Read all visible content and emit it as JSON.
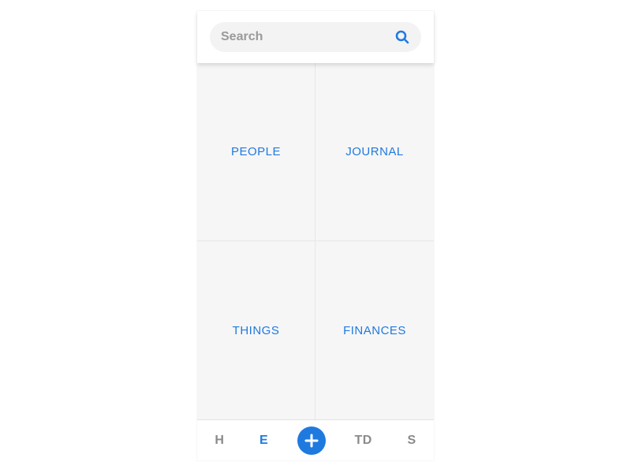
{
  "search": {
    "placeholder": "Search"
  },
  "tiles": [
    {
      "label": "PEOPLE"
    },
    {
      "label": "JOURNAL"
    },
    {
      "label": "THINGS"
    },
    {
      "label": "FINANCES"
    }
  ],
  "tabs": {
    "h": "H",
    "e": "E",
    "td": "TD",
    "s": "S"
  },
  "colors": {
    "accent": "#1f7ae0"
  }
}
